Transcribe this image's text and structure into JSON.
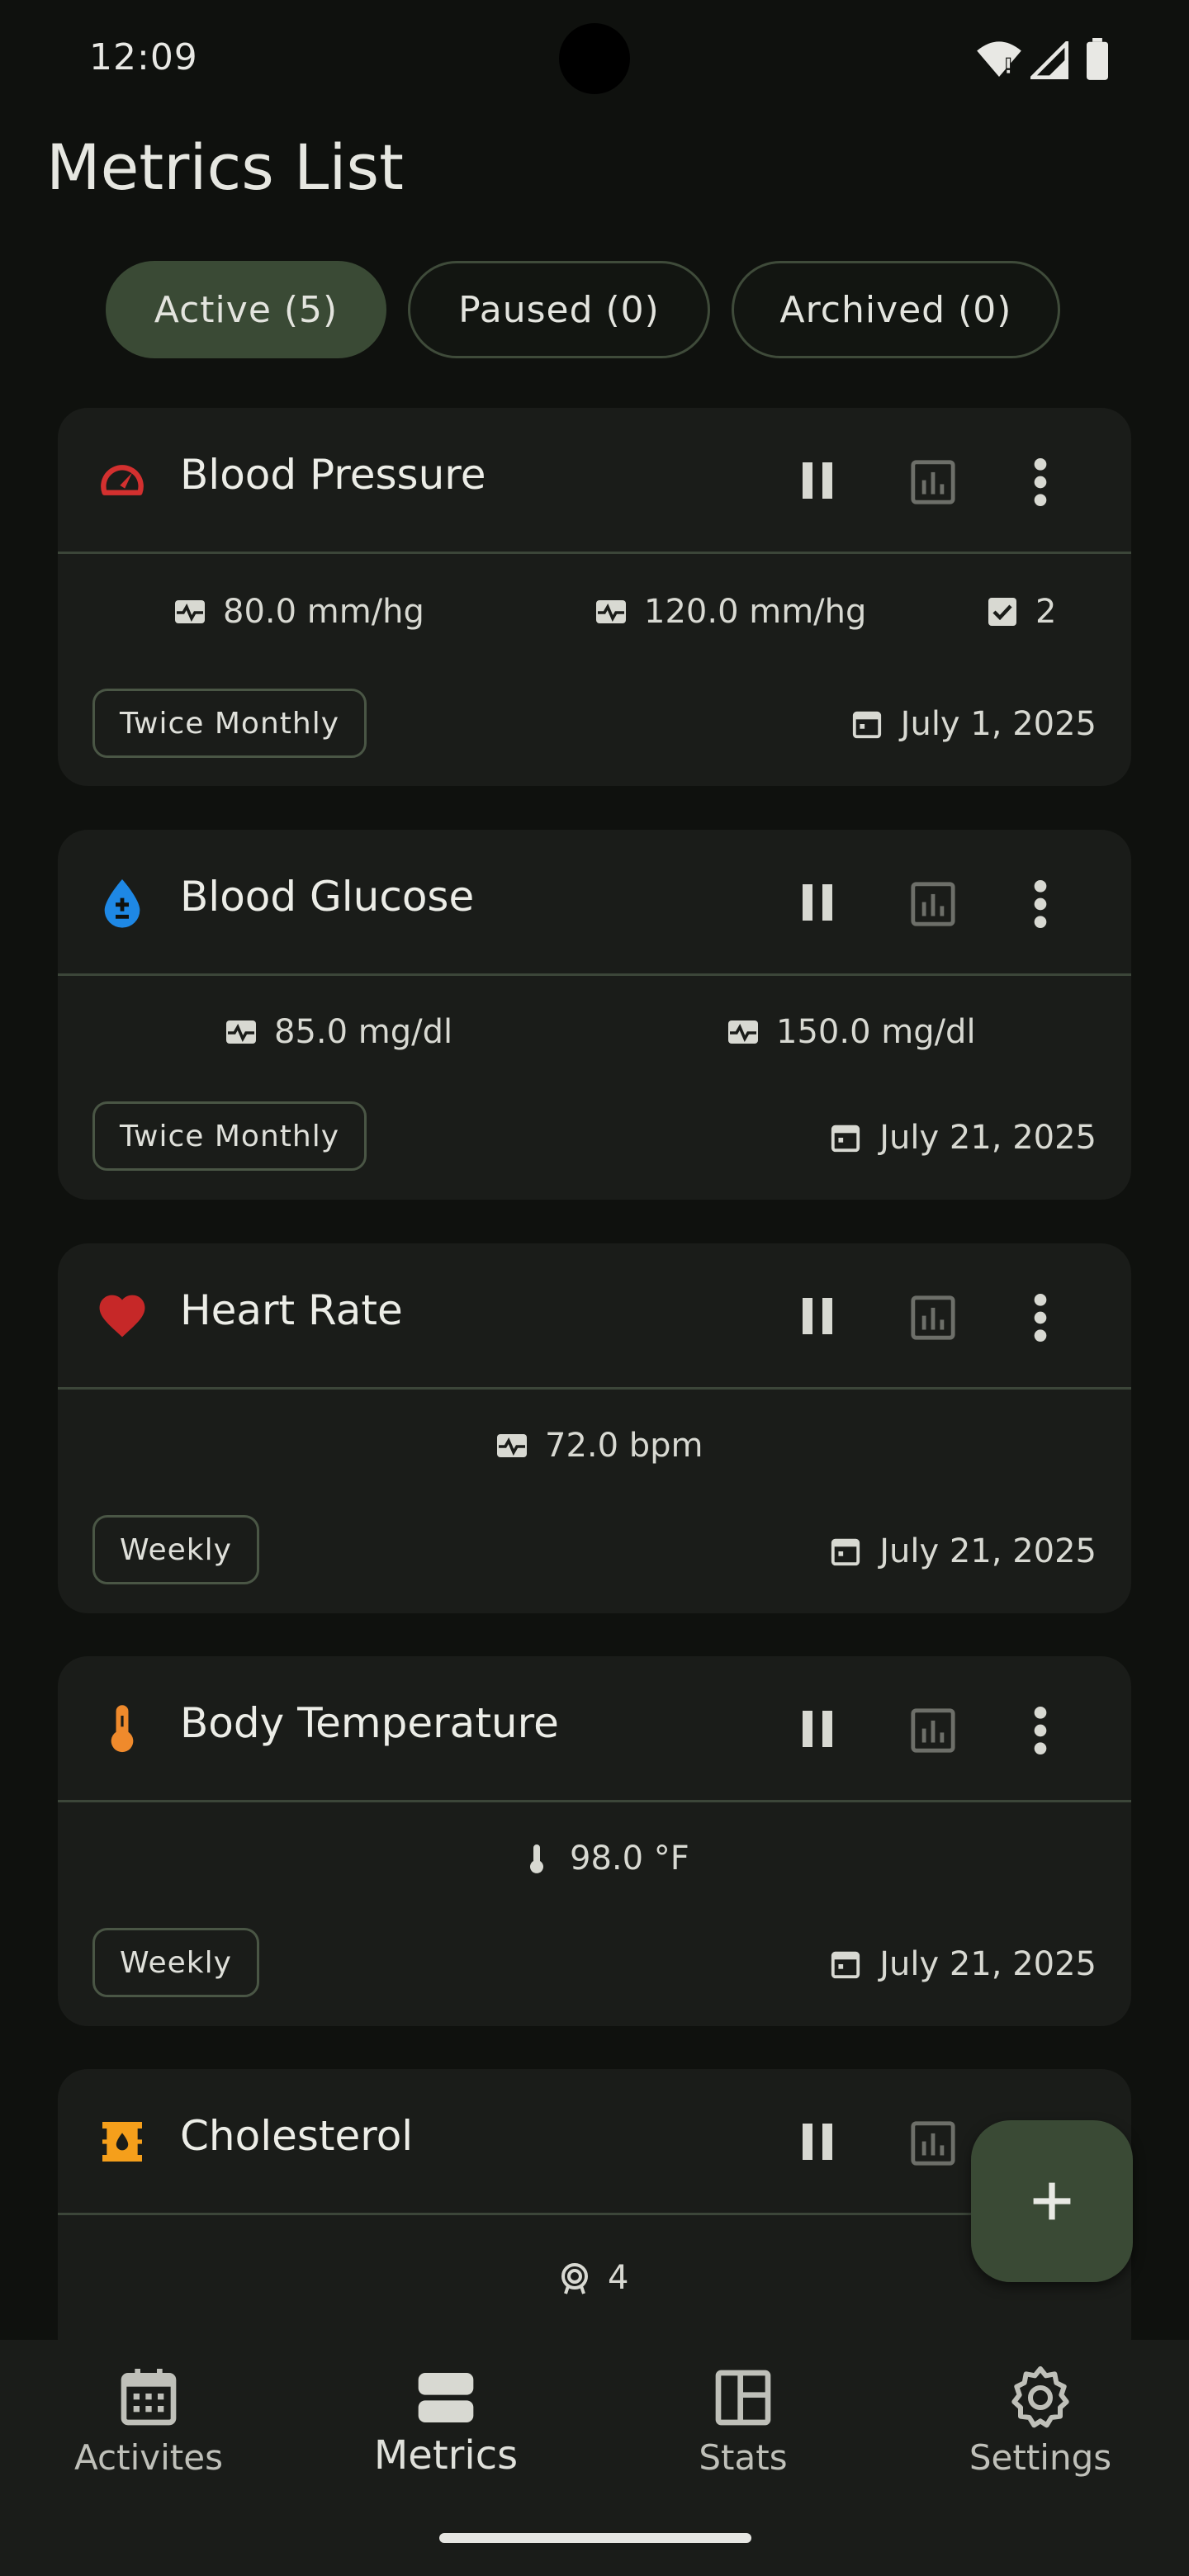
{
  "status_bar": {
    "time": "12:09",
    "icons": [
      "wifi-icon",
      "signal-icon",
      "battery-icon"
    ]
  },
  "page": {
    "title": "Metrics List"
  },
  "filters": [
    {
      "label": "Active (5)",
      "selected": true
    },
    {
      "label": "Paused (0)",
      "selected": false
    },
    {
      "label": "Archived (0)",
      "selected": false
    }
  ],
  "metrics": [
    {
      "name": "Blood Pressure",
      "icon": "speedometer-icon",
      "icon_color": "#d3302f",
      "readings": [
        {
          "icon": "monitor-heart-icon",
          "value": "80.0 mm/hg"
        },
        {
          "icon": "monitor-heart-icon",
          "value": "120.0 mm/hg"
        },
        {
          "icon": "checkbox-icon",
          "value": "2"
        }
      ],
      "frequency": "Twice Monthly",
      "date": "July 1, 2025"
    },
    {
      "name": "Blood Glucose",
      "icon": "drop-icon",
      "icon_color": "#1e88e5",
      "readings": [
        {
          "icon": "monitor-heart-icon",
          "value": "85.0 mg/dl"
        },
        {
          "icon": "monitor-heart-icon",
          "value": "150.0 mg/dl"
        }
      ],
      "frequency": "Twice Monthly",
      "date": "July 21, 2025"
    },
    {
      "name": "Heart Rate",
      "icon": "heart-icon",
      "icon_color": "#c62828",
      "readings": [
        {
          "icon": "monitor-heart-icon",
          "value": "72.0 bpm"
        }
      ],
      "frequency": "Weekly",
      "date": "July 21, 2025"
    },
    {
      "name": "Body Temperature",
      "icon": "thermometer-icon",
      "icon_color": "#ef8a2c",
      "readings": [
        {
          "icon": "thermometer-icon",
          "value": "98.0 °F"
        }
      ],
      "frequency": "Weekly",
      "date": "July 21, 2025"
    },
    {
      "name": "Cholesterol",
      "icon": "oil-barrel-icon",
      "icon_color": "#f59f1b",
      "readings": [
        {
          "icon": "target-icon",
          "value": "4"
        }
      ],
      "frequency": "",
      "date": ""
    }
  ],
  "fab": {
    "icon": "plus-icon"
  },
  "bottom_nav": [
    {
      "label": "Activites",
      "icon": "calendar-icon",
      "selected": false
    },
    {
      "label": "Metrics",
      "icon": "metrics-icon",
      "selected": true
    },
    {
      "label": "Stats",
      "icon": "dashboard-icon",
      "selected": false
    },
    {
      "label": "Settings",
      "icon": "gear-icon",
      "selected": false
    }
  ],
  "colors": {
    "background": "#0f110e",
    "card": "#1a1c19",
    "accent": "#3a4a35",
    "divider": "#3c4639"
  }
}
